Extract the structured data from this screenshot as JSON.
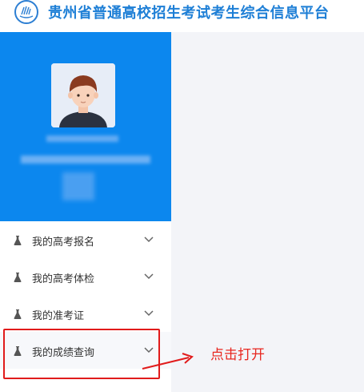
{
  "header": {
    "title": "贵州省普通高校招生考试考生综合信息平台",
    "logo_icon": "exam-board-logo"
  },
  "profile": {
    "avatar_icon": "user-avatar",
    "name": "",
    "id_number": ""
  },
  "menu": {
    "items": [
      {
        "label": "我的高考报名",
        "icon": "flask-icon",
        "expanded": false
      },
      {
        "label": "我的高考体检",
        "icon": "flask-icon",
        "expanded": false
      },
      {
        "label": "我的准考证",
        "icon": "flask-icon",
        "expanded": false
      },
      {
        "label": "我的成绩查询",
        "icon": "flask-icon",
        "expanded": false
      }
    ]
  },
  "annotation": {
    "text": "点击打开",
    "color": "#e8261f"
  },
  "colors": {
    "brand": "#1e7fd6",
    "profile_bg": "#0c87ee",
    "content_bg": "#f3f4f8",
    "highlight": "#e11b1b"
  }
}
